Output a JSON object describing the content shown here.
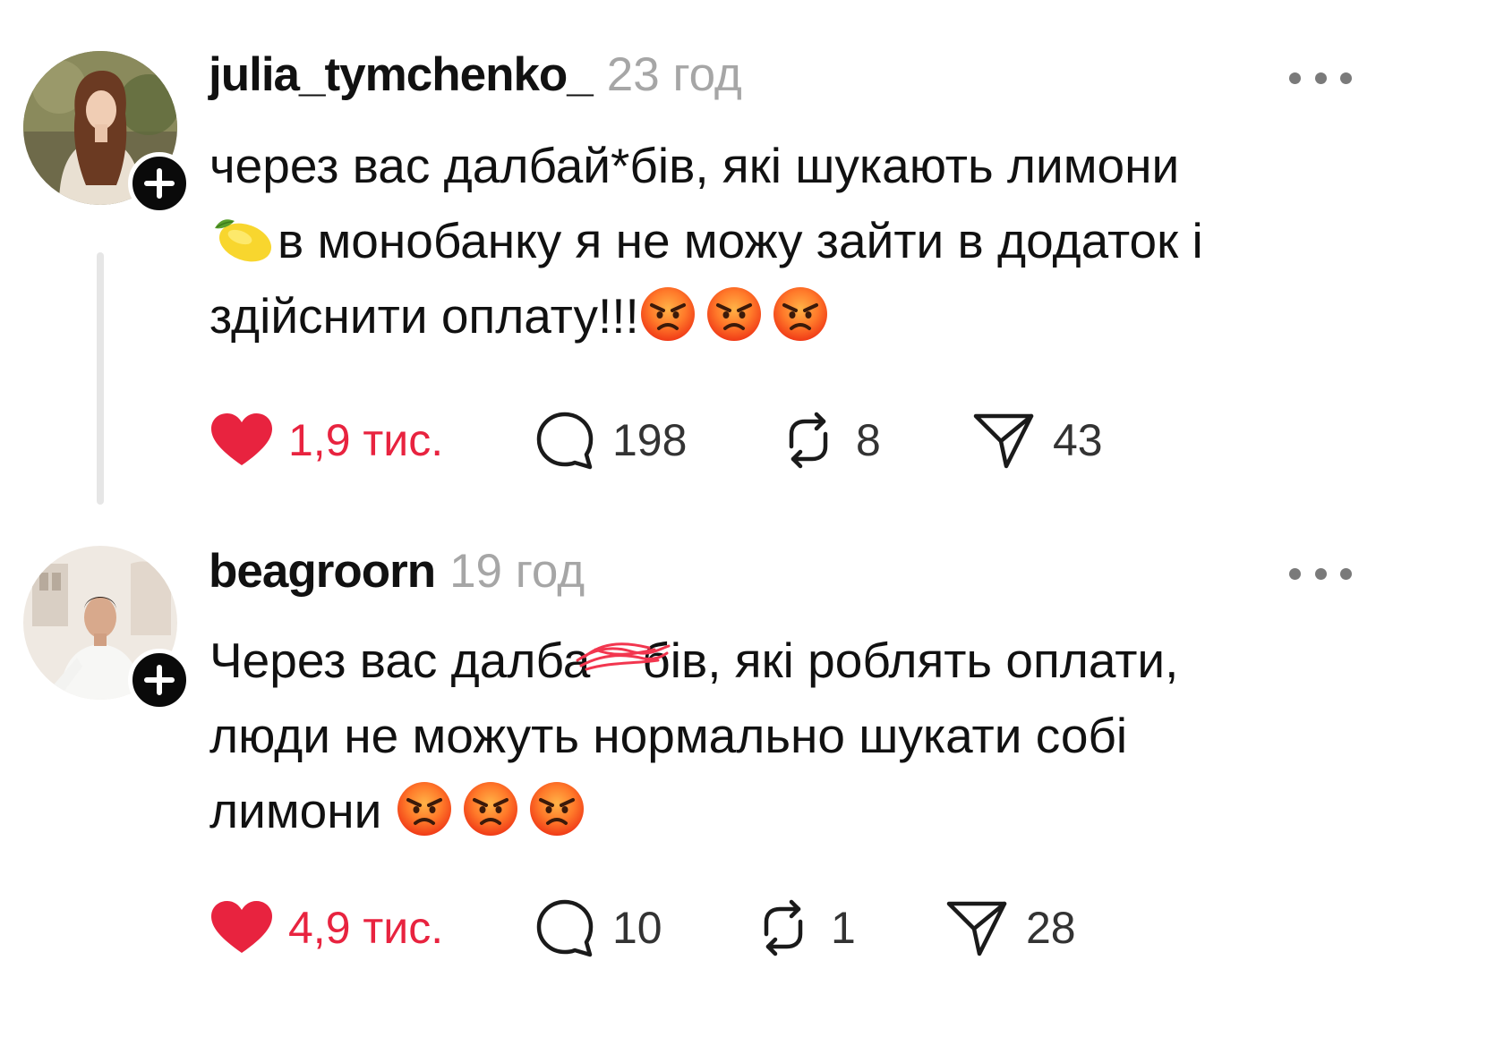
{
  "posts": [
    {
      "username": "julia_tymchenko_",
      "timestamp": "23 год",
      "body_lines": [
        "через вас далбай*бів, які шукають лимони",
        "в монобанку я не можу зайти в додаток і",
        "здійснити оплату!!!"
      ],
      "likes": "1,9 тис.",
      "replies": "198",
      "reposts": "8",
      "shares": "43",
      "liked": true
    },
    {
      "username": "beagroorn",
      "timestamp": "19 год",
      "body_lines": [
        "Через вас далба",
        "бів, які роблять оплати,",
        "люди не можуть нормально шукати собі",
        "лимони"
      ],
      "likes": "4,9 тис.",
      "replies": "10",
      "reposts": "1",
      "shares": "28",
      "liked": true
    }
  ],
  "colors": {
    "like": "#e8233f",
    "username": "#111111",
    "timestamp": "#a6a6a6",
    "thread_line": "#e6e6e6",
    "censor_scribble": "#f2364f"
  },
  "icons": [
    "heart-icon",
    "comment-icon",
    "repost-icon",
    "share-icon",
    "more-icon",
    "plus-icon",
    "lemon-emoji",
    "angry-face-emoji"
  ]
}
